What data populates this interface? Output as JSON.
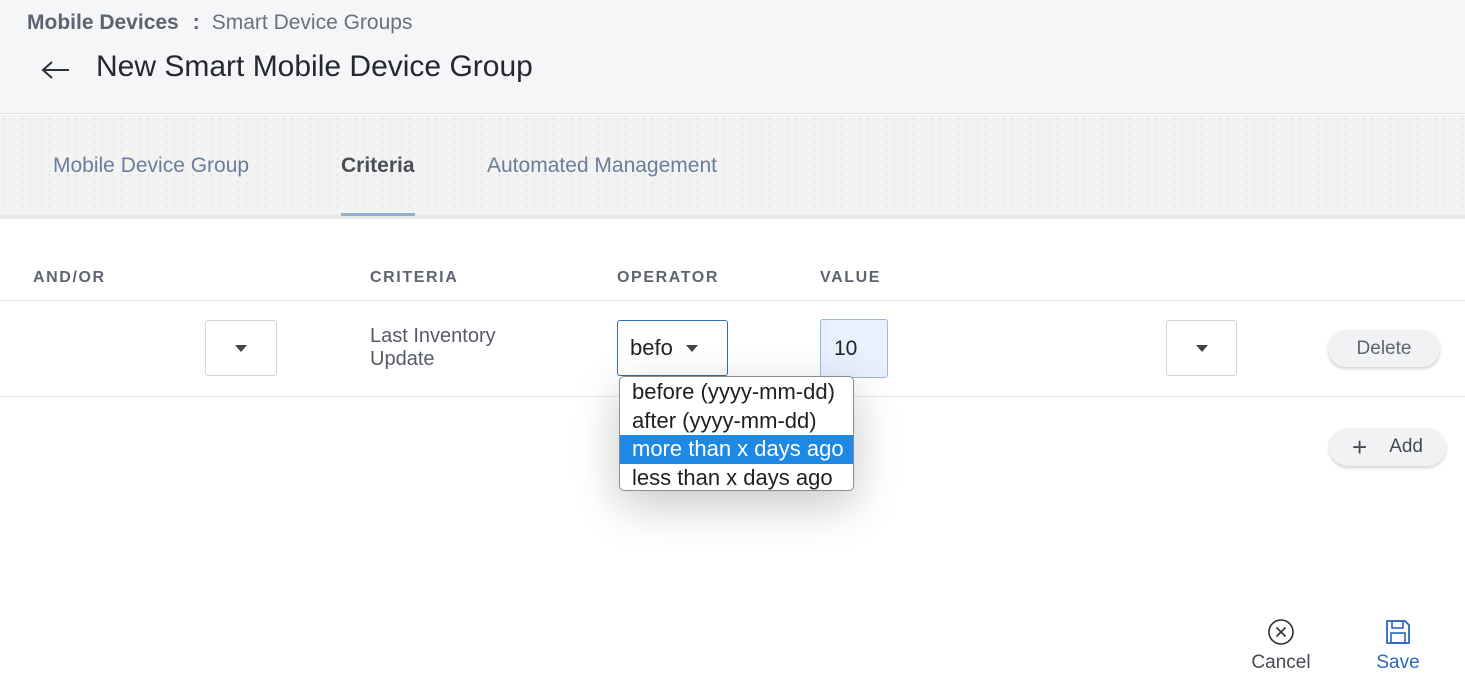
{
  "breadcrumb": {
    "root": "Mobile Devices",
    "separator": ":",
    "current": "Smart Device Groups"
  },
  "page": {
    "title": "New Smart Mobile Device Group",
    "back_icon": "arrow-left-icon"
  },
  "tabs": [
    {
      "label": "Mobile Device Group",
      "active": false
    },
    {
      "label": "Criteria",
      "active": true
    },
    {
      "label": "Automated Management",
      "active": false
    }
  ],
  "table": {
    "headers": {
      "andor": "AND/OR",
      "criteria": "CRITERIA",
      "operator": "OPERATOR",
      "value": "VALUE"
    },
    "row": {
      "criteria": "Last Inventory Update",
      "operator_display": "before (yyyy-mm-dd)",
      "value": "10",
      "delete_label": "Delete"
    }
  },
  "operator_options": [
    {
      "label": "before (yyyy-mm-dd)",
      "highlighted": false
    },
    {
      "label": "after (yyyy-mm-dd)",
      "highlighted": false
    },
    {
      "label": "more than x days ago",
      "highlighted": true
    },
    {
      "label": "less than x days ago",
      "highlighted": false
    }
  ],
  "actions": {
    "add_label": "Add",
    "cancel_label": "Cancel",
    "save_label": "Save"
  },
  "colors": {
    "accent": "#2a66c2",
    "highlight": "#1e88e5",
    "header_bg": "#f5f6f8"
  }
}
